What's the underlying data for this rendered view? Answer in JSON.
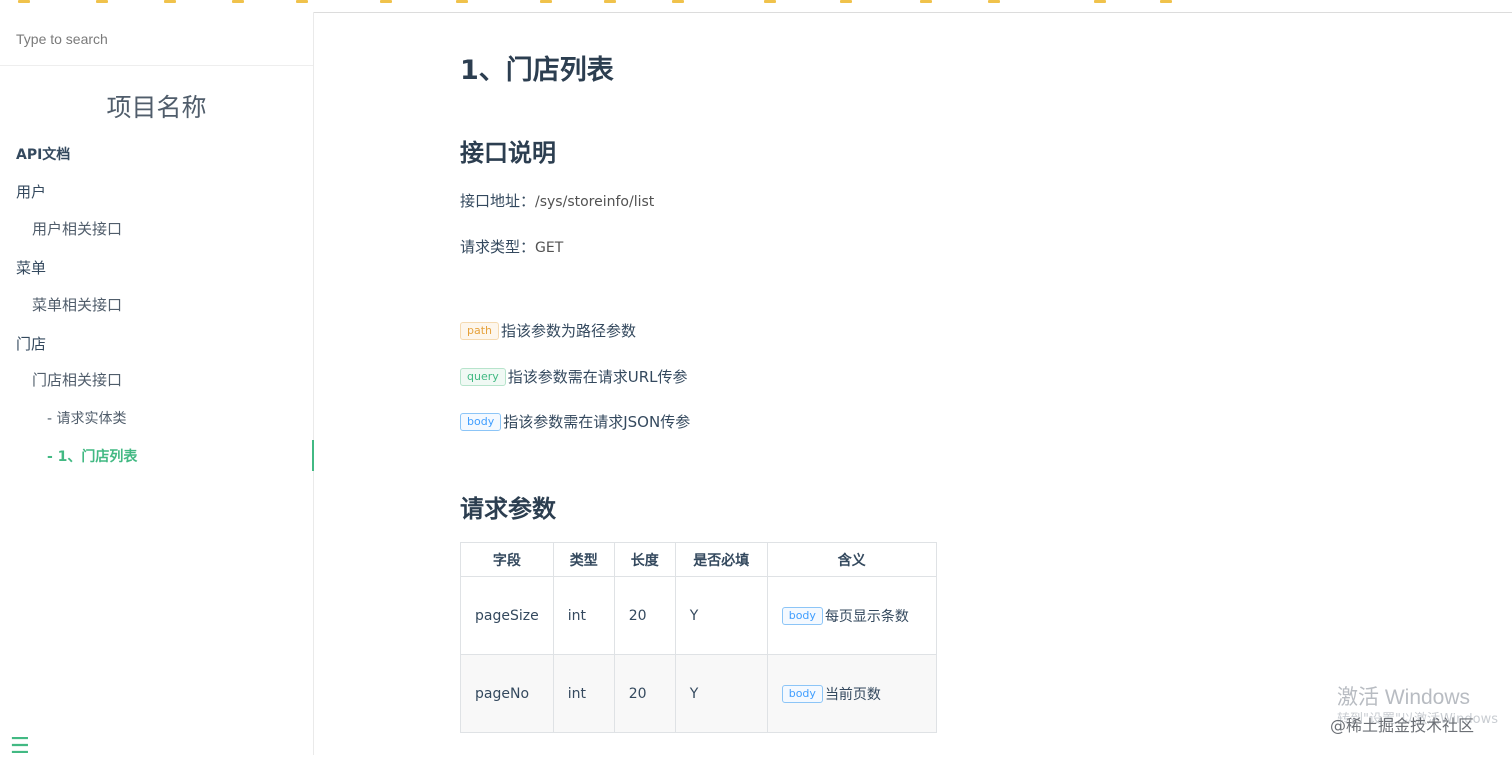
{
  "search": {
    "placeholder": "Type to search"
  },
  "app_name": "项目名称",
  "sidebar": {
    "items": [
      {
        "label": "API文档"
      },
      {
        "label": "用户"
      },
      {
        "label": "用户相关接口"
      },
      {
        "label": "菜单"
      },
      {
        "label": "菜单相关接口"
      },
      {
        "label": "门店"
      },
      {
        "label": "门店相关接口"
      },
      {
        "label": "- 请求实体类"
      },
      {
        "label": "- 1、门店列表"
      }
    ]
  },
  "main": {
    "title": "1、门店列表",
    "section_interface": "接口说明",
    "address_label": "接口地址：",
    "address_value": "/sys/storeinfo/list",
    "method_label": "请求类型：",
    "method_value": "GET",
    "legend": [
      {
        "tag": "path",
        "text": "指该参数为路径参数"
      },
      {
        "tag": "query",
        "text": "指该参数需在请求URL传参"
      },
      {
        "tag": "body",
        "text": "指该参数需在请求JSON传参"
      }
    ],
    "section_params": "请求参数",
    "table": {
      "headers": [
        "字段",
        "类型",
        "长度",
        "是否必填",
        "含义"
      ],
      "rows": [
        {
          "field": "pageSize",
          "type": "int",
          "length": "20",
          "required": "Y",
          "tag": "body",
          "meaning": "每页显示条数"
        },
        {
          "field": "pageNo",
          "type": "int",
          "length": "20",
          "required": "Y",
          "tag": "body",
          "meaning": "当前页数"
        }
      ]
    }
  },
  "overlay": {
    "windows_activation": "激活 Windows",
    "windows_activation_sub": "转到\"设置\"以激活Windows",
    "credit": "@稀土掘金技术社区"
  },
  "colors": {
    "accent": "#42b983",
    "text": "#34495e",
    "heading": "#2c3e50",
    "path_tag": "#e6a23c",
    "body_tag": "#409eff"
  }
}
